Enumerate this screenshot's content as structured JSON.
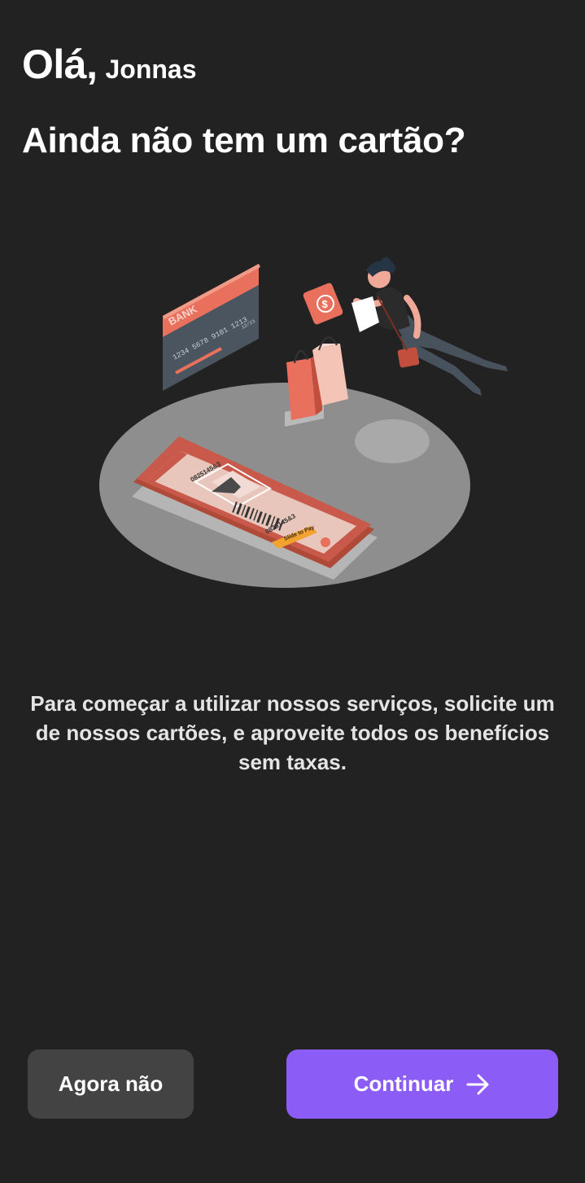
{
  "greeting": {
    "hello": "Olá,",
    "name": "Jonnas"
  },
  "headline": "Ainda não tem um cartão?",
  "illustration": {
    "card_brand": "BANK",
    "card_number": "1234 5678 9101 1213",
    "card_expiry": "12/23",
    "phone_code_top": "0825145&3",
    "phone_code_bottom": "0825145&3",
    "slide_label": "Slide to Pay",
    "money_symbol": "$",
    "colors": {
      "accent": "#e8705d",
      "platform": "#8e8e8e",
      "card_body": "#4a5560"
    }
  },
  "description": "Para começar a utilizar nossos serviços, solicite um de nossos cartões, e aproveite todos os benefícios sem taxas.",
  "buttons": {
    "secondary_label": "Agora não",
    "primary_label": "Continuar",
    "primary_icon": "arrow-right-icon",
    "primary_color": "#8b5cf6",
    "secondary_color": "#434343"
  }
}
